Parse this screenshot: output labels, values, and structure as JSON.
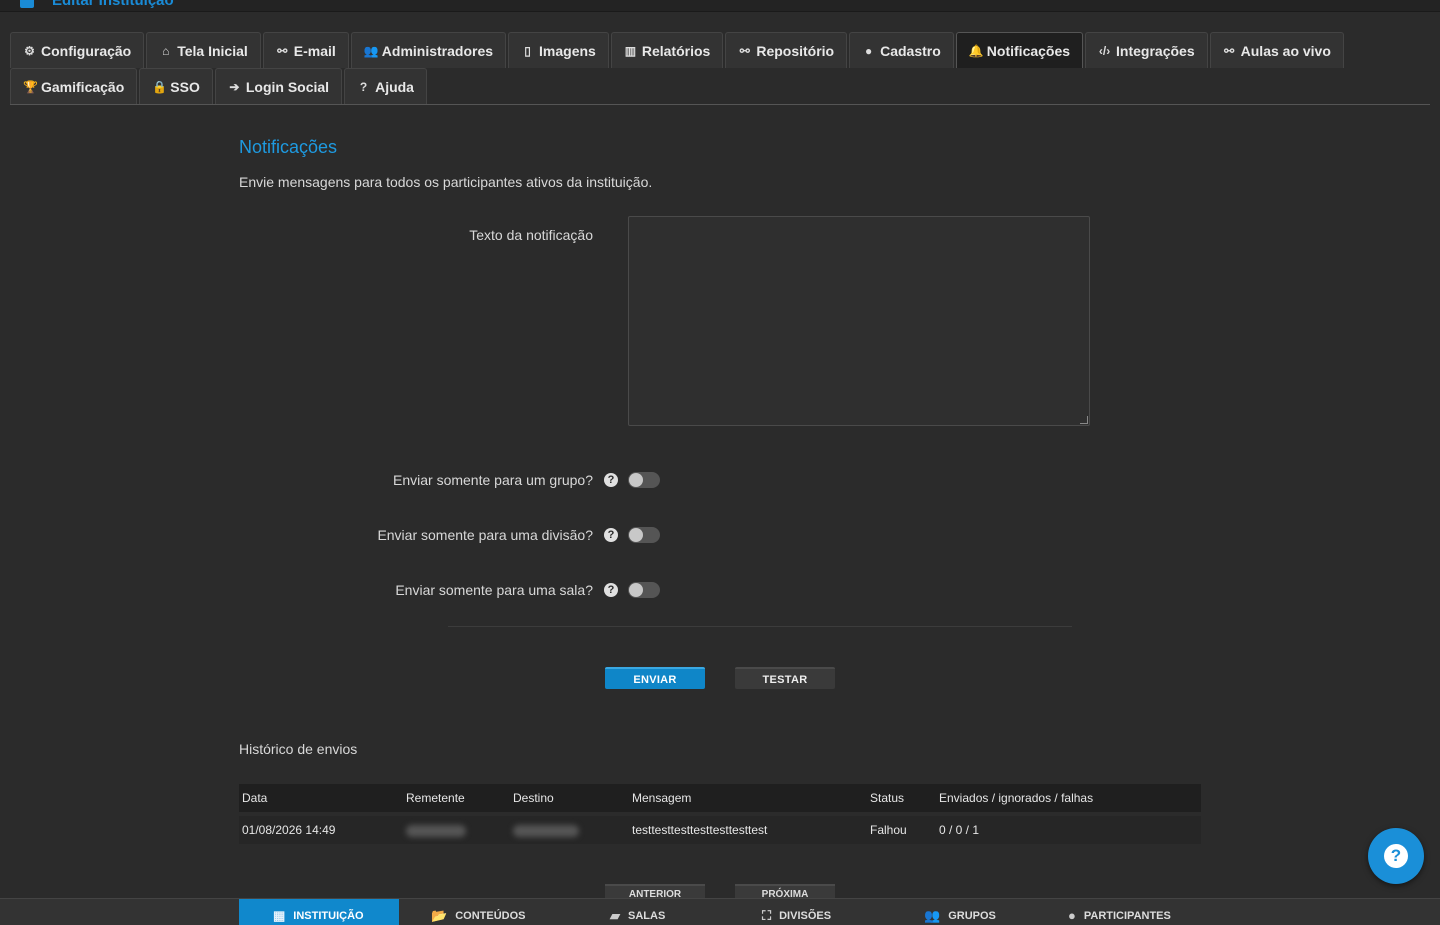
{
  "header": {
    "title": "Editar Instituição"
  },
  "tabs": [
    [
      {
        "label": "Configuração",
        "icon": "gears-icon",
        "glyph": "⚙"
      },
      {
        "label": "Tela Inicial",
        "icon": "home-icon",
        "glyph": "⌂"
      },
      {
        "label": "E-mail",
        "icon": "link-icon",
        "glyph": "⚯"
      },
      {
        "label": "Administradores",
        "icon": "users-icon",
        "glyph": "👥"
      },
      {
        "label": "Imagens",
        "icon": "file-icon",
        "glyph": "▯"
      },
      {
        "label": "Relatórios",
        "icon": "bar-chart-icon",
        "glyph": "▥"
      },
      {
        "label": "Repositório",
        "icon": "link-icon",
        "glyph": "⚯"
      },
      {
        "label": "Cadastro",
        "icon": "user-icon",
        "glyph": "●"
      },
      {
        "label": "Notificações",
        "icon": "bell-icon",
        "glyph": "🔔",
        "active": true
      },
      {
        "label": "Integrações",
        "icon": "code-icon",
        "glyph": "‹/›"
      },
      {
        "label": "Aulas ao vivo",
        "icon": "link-icon",
        "glyph": "⚯"
      }
    ],
    [
      {
        "label": "Gamificação",
        "icon": "trophy-icon",
        "glyph": "🏆"
      },
      {
        "label": "SSO",
        "icon": "lock-icon",
        "glyph": "🔒"
      },
      {
        "label": "Login Social",
        "icon": "sign-in-icon",
        "glyph": "➔"
      },
      {
        "label": "Ajuda",
        "icon": "question-circle-icon",
        "glyph": "?"
      }
    ]
  ],
  "notifications": {
    "title": "Notificações",
    "description": "Envie mensagens para todos os participantes ativos da instituição.",
    "text_label": "Texto da notificação",
    "text_value": "",
    "options": [
      {
        "label": "Enviar somente para um grupo?",
        "enabled": false
      },
      {
        "label": "Enviar somente para uma divisão?",
        "enabled": false
      },
      {
        "label": "Enviar somente para uma sala?",
        "enabled": false
      }
    ],
    "send_button": "ENVIAR",
    "test_button": "TESTAR"
  },
  "history": {
    "title": "Histórico de envios",
    "columns": [
      "Data",
      "Remetente",
      "Destino",
      "Mensagem",
      "Status",
      "Enviados / ignorados / falhas"
    ],
    "rows": [
      {
        "date": "01/08/2026 14:49",
        "sender": "",
        "destination": "",
        "message": "testtesttesttesttesttesttest",
        "status": "Falhou",
        "counts": "0 / 0 / 1"
      }
    ],
    "prev_button": "ANTERIOR",
    "next_button": "PRÓXIMA"
  },
  "bottom_nav": [
    {
      "label": "INSTITUIÇÃO",
      "icon": "building-icon",
      "glyph": "▦",
      "active": true
    },
    {
      "label": "CONTEÚDOS",
      "icon": "folder-open-icon",
      "glyph": "📂"
    },
    {
      "label": "SALAS",
      "icon": "book-icon",
      "glyph": "▰"
    },
    {
      "label": "DIVISÕES",
      "icon": "sitemap-icon",
      "glyph": "⛶"
    },
    {
      "label": "GRUPOS",
      "icon": "users-icon",
      "glyph": "👥"
    },
    {
      "label": "PARTICIPANTES",
      "icon": "user-icon",
      "glyph": "●"
    }
  ],
  "colors": {
    "accent": "#1e9ae0",
    "primary_button": "#0f86c8",
    "background": "#2b2b2b"
  }
}
